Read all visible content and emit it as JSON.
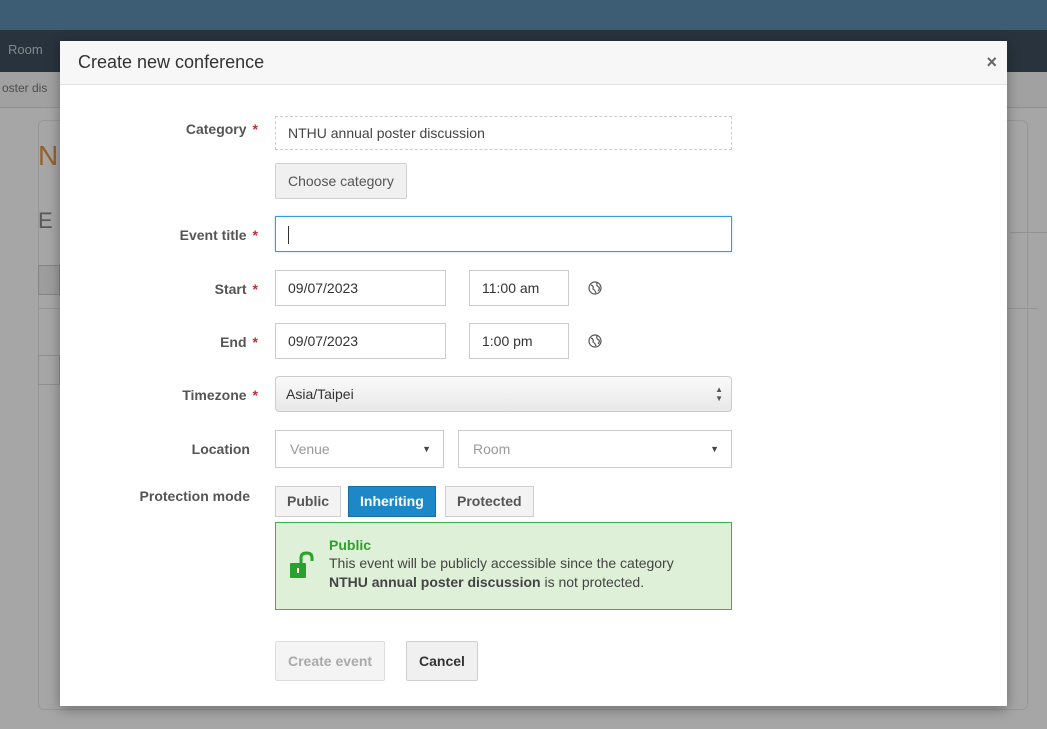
{
  "background": {
    "nav_room": "Room",
    "crumb": "oster dis",
    "title_initial": "N",
    "subtitle_initial": "E"
  },
  "modal": {
    "title": "Create new conference",
    "close_glyph": "×"
  },
  "form": {
    "required_mark": "*",
    "category": {
      "label": "Category",
      "value": "NTHU annual poster discussion",
      "button": "Choose category"
    },
    "event_title": {
      "label": "Event title",
      "value": ""
    },
    "start": {
      "label": "Start",
      "date": "09/07/2023",
      "time": "11:00 am"
    },
    "end": {
      "label": "End",
      "date": "09/07/2023",
      "time": "1:00 pm"
    },
    "timezone": {
      "label": "Timezone",
      "value": "Asia/Taipei"
    },
    "location": {
      "label": "Location",
      "venue_placeholder": "Venue",
      "room_placeholder": "Room"
    },
    "protection": {
      "label": "Protection mode",
      "options": [
        "Public",
        "Inheriting",
        "Protected"
      ],
      "selected": "Inheriting",
      "message": {
        "title": "Public",
        "text_before": "This event will be publicly accessible since the category",
        "category": "NTHU annual poster discussion",
        "text_after": "is not protected."
      }
    },
    "buttons": {
      "create": "Create event",
      "cancel": "Cancel"
    }
  },
  "colors": {
    "accent": "#1c88c7",
    "success_border": "#36b34a",
    "success_bg": "#dff0d8",
    "required": "#c02d2d"
  },
  "icons": {
    "globe": "globe-icon",
    "lock": "unlocked-lock-icon",
    "close": "close-icon"
  }
}
